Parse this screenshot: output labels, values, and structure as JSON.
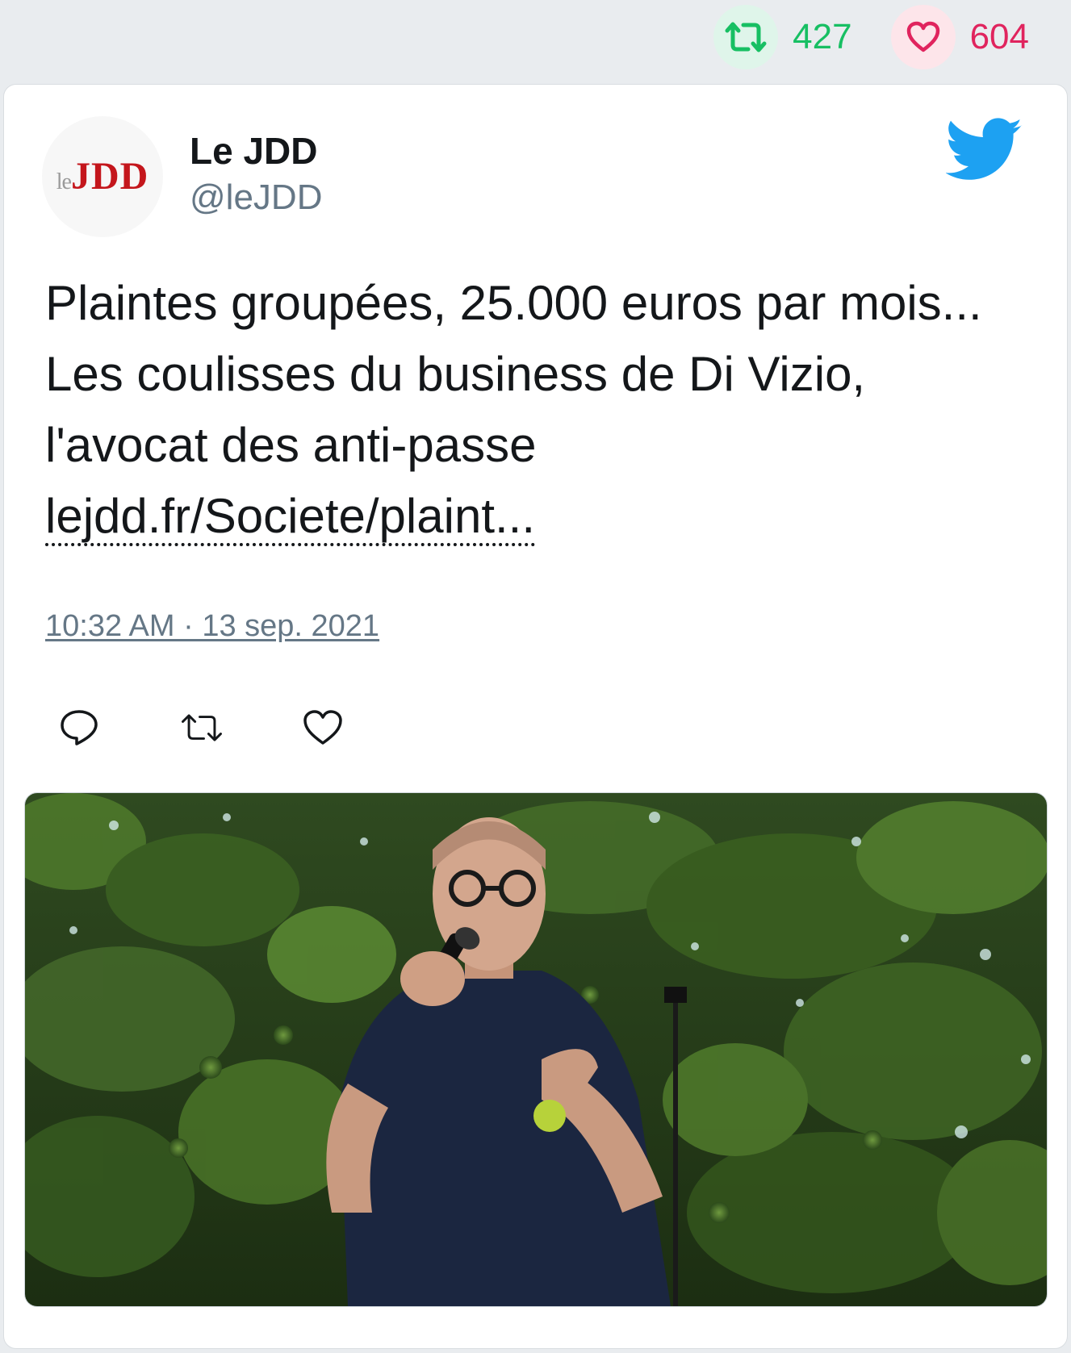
{
  "engagement": {
    "retweets": "427",
    "likes": "604"
  },
  "tweet": {
    "author_name": "Le JDD",
    "author_handle": "@leJDD",
    "avatar_logo_text": "leJDD",
    "text": "Plaintes groupées, 25.000 euros par mois... Les coulisses du business de Di Vizio, l'avocat des anti-passe ",
    "link_text": "lejdd.fr/Societe/plaint...",
    "timestamp": "10:32 AM · 13 sep. 2021"
  },
  "icons": {
    "retweet_stat": "retweet-icon",
    "like_stat": "heart-icon",
    "brand": "twitter-bird-icon",
    "reply_action": "reply-icon",
    "retweet_action": "retweet-icon",
    "like_action": "heart-icon"
  },
  "media": {
    "alt": "photo-man-speaking-microphone"
  },
  "colors": {
    "retweet_green": "#17bf63",
    "like_red": "#e0245e",
    "twitter_blue": "#1da1f2",
    "text_dark": "#14171a",
    "text_gray": "#657786"
  }
}
